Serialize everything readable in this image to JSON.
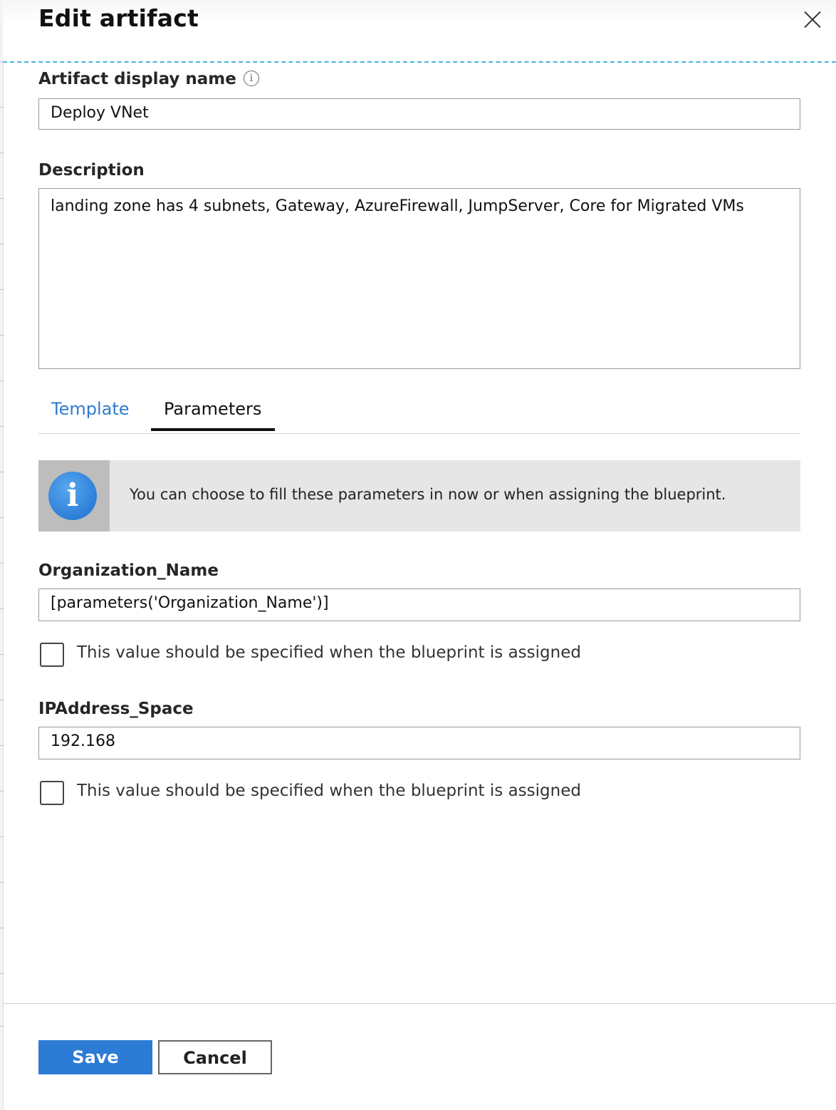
{
  "dialog": {
    "title": "Edit artifact",
    "close_icon": "close-icon"
  },
  "form": {
    "display_name_label": "Artifact display name",
    "info_icon": "info-icon",
    "info_glyph": "i",
    "display_name_value": "Deploy VNet",
    "description_label": "Description",
    "description_value": "landing zone has 4 subnets, Gateway, AzureFirewall, JumpServer, Core for Migrated VMs"
  },
  "tabs": [
    {
      "label": "Template",
      "active": false
    },
    {
      "label": "Parameters",
      "active": true
    }
  ],
  "banner": {
    "icon": "info-circle-icon",
    "glyph": "i",
    "text": "You can choose to fill these parameters in now or when assigning the blueprint."
  },
  "parameters": [
    {
      "name": "Organization_Name",
      "value": "[parameters('Organization_Name')]",
      "checkbox_label": "This value should be specified when the blueprint is assigned",
      "checked": false
    },
    {
      "name": "IPAddress_Space",
      "value": "192.168",
      "checkbox_label": "This value should be specified when the blueprint is assigned",
      "checked": false
    }
  ],
  "footer": {
    "save_label": "Save",
    "cancel_label": "Cancel"
  },
  "colors": {
    "accent": "#2c7bd4",
    "tab_link": "#2f7bd1",
    "dashed_line": "#48b4e0",
    "banner_bg": "#e6e6e6"
  }
}
